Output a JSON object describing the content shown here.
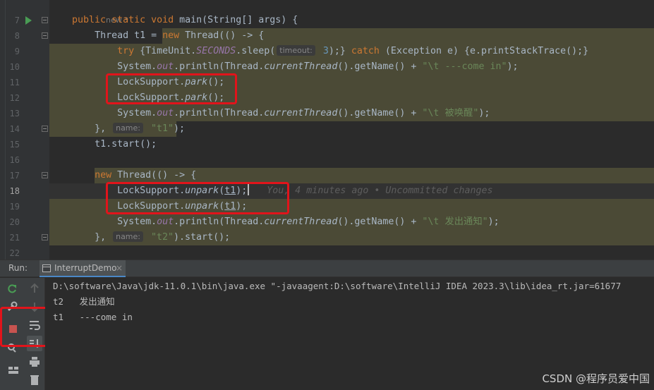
{
  "editor": {
    "author_hint": "new *",
    "line_numbers": [
      "7",
      "8",
      "9",
      "10",
      "11",
      "12",
      "13",
      "14",
      "15",
      "16",
      "17",
      "18",
      "19",
      "20",
      "21",
      "22"
    ],
    "current_line": "18",
    "lines": {
      "l7": {
        "kw1": "public static void ",
        "rest": "main(String[] args) {"
      },
      "l8": {
        "indent": "    ",
        "a": "Thread t1 = ",
        "kw": "new",
        "b": " Thread(() -> {"
      },
      "l9": {
        "indent": "        ",
        "kw": "try",
        "a": " {TimeUnit.",
        "fld": "SECONDS",
        "b": ".sleep(",
        "hint": "timeout:",
        "num": " 3",
        "c": ");} ",
        "kw2": "catch",
        "d": " (Exception e) {e.printStackTrace();}"
      },
      "l10": {
        "indent": "        ",
        "a": "System.",
        "fld": "out",
        "b": ".println(Thread.",
        "ital": "currentThread",
        "c": "().getName() + ",
        "str": "\"\\t ---come in\"",
        "d": ");"
      },
      "l11": {
        "indent": "        ",
        "a": "LockSupport.",
        "ital": "park",
        "b": "();"
      },
      "l12": {
        "indent": "        ",
        "a": "LockSupport.",
        "ital": "park",
        "b": "();"
      },
      "l13": {
        "indent": "        ",
        "a": "System.",
        "fld": "out",
        "b": ".println(Thread.",
        "ital": "currentThread",
        "c": "().getName() + ",
        "str": "\"\\t 被唤醒\"",
        "d": ");"
      },
      "l14": {
        "indent": "    ",
        "a": "}, ",
        "hint": "name:",
        "str": " \"t1\"",
        "b": ");"
      },
      "l15": {
        "indent": "    ",
        "a": "t1.start();"
      },
      "l16": {
        "text": ""
      },
      "l17": {
        "indent": "    ",
        "kw": "new",
        "a": " Thread(() -> {"
      },
      "l18": {
        "indent": "        ",
        "a": "LockSupport.",
        "ital": "unpark",
        "b": "(",
        "arg": "t1",
        "c": ");",
        "blame": "   You, 4 minutes ago • Uncommitted changes"
      },
      "l19": {
        "indent": "        ",
        "a": "LockSupport.",
        "ital": "unpark",
        "b": "(",
        "arg": "t1",
        "c": ");"
      },
      "l20": {
        "indent": "        ",
        "a": "System.",
        "fld": "out",
        "b": ".println(Thread.",
        "ital": "currentThread",
        "c": "().getName() + ",
        "str": "\"\\t 发出通知\"",
        "d": ");"
      },
      "l21": {
        "indent": "    ",
        "a": "}, ",
        "hint": "name:",
        "str": " \"t2\"",
        "b": ").start();"
      },
      "l22": {
        "text": ""
      }
    }
  },
  "run": {
    "label": "Run:",
    "tab_label": "InterruptDemo",
    "tab_close": "×",
    "console": [
      "D:\\software\\Java\\jdk-11.0.1\\bin\\java.exe \"-javaagent:D:\\software\\IntelliJ IDEA 2023.3\\lib\\idea_rt.jar=61677",
      "t2   发出通知",
      "t1   ---come in"
    ]
  },
  "watermark": "CSDN @程序员爱中国",
  "colors": {
    "keyword": "#cc7832",
    "string": "#6a8759",
    "number": "#6897bb",
    "field": "#9876aa",
    "highlight": "#4b4a36",
    "annotation_box": "#e1141b",
    "run_icon": "#499c54",
    "stop_icon": "#c75450"
  },
  "icons": [
    "run-gutter-icon",
    "lightbulb-icon",
    "rerun-icon",
    "settings-wrench-icon",
    "stop-icon",
    "soft-wrap-icon",
    "scroll-to-end-icon",
    "print-icon",
    "delete-icon",
    "layout-icon",
    "up-arrow-icon",
    "down-arrow-icon"
  ]
}
